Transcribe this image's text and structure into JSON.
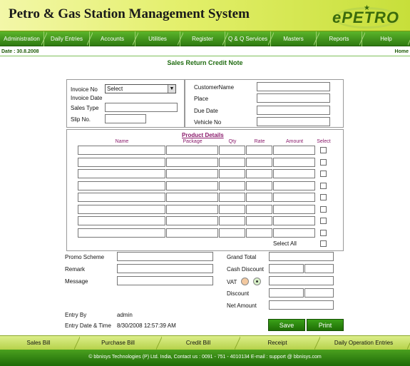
{
  "header": {
    "title": "Petro & Gas Station Management System",
    "logo_text": "ePETRO"
  },
  "nav": [
    "Administration",
    "Daily Entries",
    "Accounts",
    "Utilities",
    "Register",
    "Q & Q Services",
    "Masters",
    "Reports",
    "Help"
  ],
  "date_text": "Date : 30.8.2008",
  "home_link": "Home",
  "page_title": "Sales Return Credit Note",
  "invoice": {
    "invoice_no_label": "Invoice No",
    "invoice_no_value": "Select",
    "invoice_date_label": "Invoice Date",
    "sales_type_label": "Sales Type",
    "slip_no_label": "Slip No."
  },
  "customer": {
    "name_label": "CustomerName",
    "place_label": "Place",
    "due_date_label": "Due Date",
    "vehicle_label": "Vehicle No"
  },
  "product": {
    "title": "Product Details",
    "columns": [
      "Name",
      "Package",
      "Qty",
      "Rate",
      "Amount",
      "Select"
    ],
    "row_count": 8,
    "select_all_label": "Select All"
  },
  "left_fields": {
    "promo_label": "Promo Scheme",
    "remark_label": "Remark",
    "message_label": "Message"
  },
  "totals": {
    "grand_total_label": "Grand Total",
    "cash_discount_label": "Cash Discount",
    "vat_label": "VAT",
    "discount_label": "Discount",
    "net_amount_label": "Net Amount"
  },
  "entry": {
    "by_label": "Entry By",
    "by_value": "admin",
    "datetime_label": "Entry Date & Time",
    "datetime_value": "8/30/2008 12:57:39 AM"
  },
  "buttons": {
    "save": "Save",
    "print": "Print"
  },
  "bottom_nav": [
    "Sales Bill",
    "Purchase Bill",
    "Credit Bill",
    "Receipt",
    "Daily Operation Entries"
  ],
  "footer": "© bbnisys Technologies (P) Ltd. India, Contact us : 0091 - 751 - 4010134 E-mail : support @ bbnisys.com",
  "colors": {
    "nav_green": "#2f7a12",
    "header_yellow": "#e3ef6a",
    "label_purple": "#8a1a6b"
  }
}
